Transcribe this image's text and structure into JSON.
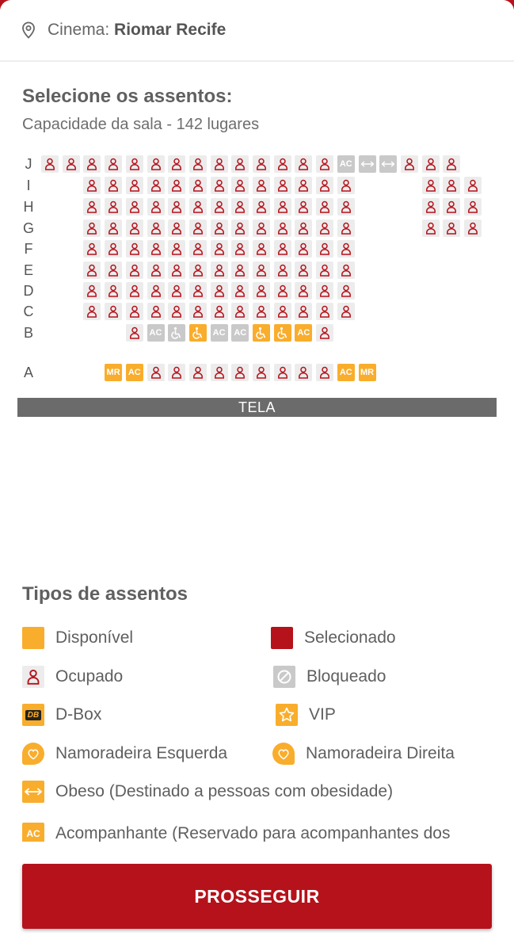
{
  "header": {
    "cinema_label": "Cinema:",
    "cinema_name": "Riomar Recife",
    "icon": "location-pin-icon"
  },
  "seat_selection": {
    "title": "Selecione os assentos:",
    "capacity": "Capacidade da sala - 142 lugares"
  },
  "seat_map": {
    "screen_label": "TELA",
    "rows": [
      {
        "label": "J",
        "seats": [
          {
            "col": 0,
            "type": "occupied"
          },
          {
            "col": 1,
            "type": "occupied"
          },
          {
            "col": 2,
            "type": "occupied"
          },
          {
            "col": 3,
            "type": "occupied"
          },
          {
            "col": 4,
            "type": "occupied"
          },
          {
            "col": 5,
            "type": "occupied"
          },
          {
            "col": 6,
            "type": "occupied"
          },
          {
            "col": 7,
            "type": "occupied"
          },
          {
            "col": 8,
            "type": "occupied"
          },
          {
            "col": 9,
            "type": "occupied"
          },
          {
            "col": 10,
            "type": "occupied"
          },
          {
            "col": 11,
            "type": "occupied"
          },
          {
            "col": 12,
            "type": "occupied"
          },
          {
            "col": 13,
            "type": "occupied"
          },
          {
            "col": 14,
            "type": "ac-blocked",
            "text": "AC"
          },
          {
            "col": 15,
            "type": "obese-blocked"
          },
          {
            "col": 16,
            "type": "obese-blocked"
          },
          {
            "col": 17,
            "type": "occupied"
          },
          {
            "col": 18,
            "type": "occupied"
          },
          {
            "col": 19,
            "type": "occupied"
          }
        ]
      },
      {
        "label": "I",
        "seats": [
          {
            "col": 2,
            "type": "occupied"
          },
          {
            "col": 3,
            "type": "occupied"
          },
          {
            "col": 4,
            "type": "occupied"
          },
          {
            "col": 5,
            "type": "occupied"
          },
          {
            "col": 6,
            "type": "occupied"
          },
          {
            "col": 7,
            "type": "occupied"
          },
          {
            "col": 8,
            "type": "occupied"
          },
          {
            "col": 9,
            "type": "occupied"
          },
          {
            "col": 10,
            "type": "occupied"
          },
          {
            "col": 11,
            "type": "occupied"
          },
          {
            "col": 12,
            "type": "occupied"
          },
          {
            "col": 13,
            "type": "occupied"
          },
          {
            "col": 14,
            "type": "occupied"
          },
          {
            "col": 18,
            "type": "occupied"
          },
          {
            "col": 19,
            "type": "occupied"
          },
          {
            "col": 20,
            "type": "occupied"
          }
        ]
      },
      {
        "label": "H",
        "seats": [
          {
            "col": 2,
            "type": "occupied"
          },
          {
            "col": 3,
            "type": "occupied"
          },
          {
            "col": 4,
            "type": "occupied"
          },
          {
            "col": 5,
            "type": "occupied"
          },
          {
            "col": 6,
            "type": "occupied"
          },
          {
            "col": 7,
            "type": "occupied"
          },
          {
            "col": 8,
            "type": "occupied"
          },
          {
            "col": 9,
            "type": "occupied"
          },
          {
            "col": 10,
            "type": "occupied"
          },
          {
            "col": 11,
            "type": "occupied"
          },
          {
            "col": 12,
            "type": "occupied"
          },
          {
            "col": 13,
            "type": "occupied"
          },
          {
            "col": 14,
            "type": "occupied"
          },
          {
            "col": 18,
            "type": "occupied"
          },
          {
            "col": 19,
            "type": "occupied"
          },
          {
            "col": 20,
            "type": "occupied"
          }
        ]
      },
      {
        "label": "G",
        "seats": [
          {
            "col": 2,
            "type": "occupied"
          },
          {
            "col": 3,
            "type": "occupied"
          },
          {
            "col": 4,
            "type": "occupied"
          },
          {
            "col": 5,
            "type": "occupied"
          },
          {
            "col": 6,
            "type": "occupied"
          },
          {
            "col": 7,
            "type": "occupied"
          },
          {
            "col": 8,
            "type": "occupied"
          },
          {
            "col": 9,
            "type": "occupied"
          },
          {
            "col": 10,
            "type": "occupied"
          },
          {
            "col": 11,
            "type": "occupied"
          },
          {
            "col": 12,
            "type": "occupied"
          },
          {
            "col": 13,
            "type": "occupied"
          },
          {
            "col": 14,
            "type": "occupied"
          },
          {
            "col": 18,
            "type": "occupied"
          },
          {
            "col": 19,
            "type": "occupied"
          },
          {
            "col": 20,
            "type": "occupied"
          }
        ]
      },
      {
        "label": "F",
        "seats": [
          {
            "col": 2,
            "type": "occupied"
          },
          {
            "col": 3,
            "type": "occupied"
          },
          {
            "col": 4,
            "type": "occupied"
          },
          {
            "col": 5,
            "type": "occupied"
          },
          {
            "col": 6,
            "type": "occupied"
          },
          {
            "col": 7,
            "type": "occupied"
          },
          {
            "col": 8,
            "type": "occupied"
          },
          {
            "col": 9,
            "type": "occupied"
          },
          {
            "col": 10,
            "type": "occupied"
          },
          {
            "col": 11,
            "type": "occupied"
          },
          {
            "col": 12,
            "type": "occupied"
          },
          {
            "col": 13,
            "type": "occupied"
          },
          {
            "col": 14,
            "type": "occupied"
          }
        ]
      },
      {
        "label": "E",
        "seats": [
          {
            "col": 2,
            "type": "occupied"
          },
          {
            "col": 3,
            "type": "occupied"
          },
          {
            "col": 4,
            "type": "occupied"
          },
          {
            "col": 5,
            "type": "occupied"
          },
          {
            "col": 6,
            "type": "occupied"
          },
          {
            "col": 7,
            "type": "occupied"
          },
          {
            "col": 8,
            "type": "occupied"
          },
          {
            "col": 9,
            "type": "occupied"
          },
          {
            "col": 10,
            "type": "occupied"
          },
          {
            "col": 11,
            "type": "occupied"
          },
          {
            "col": 12,
            "type": "occupied"
          },
          {
            "col": 13,
            "type": "occupied"
          },
          {
            "col": 14,
            "type": "occupied"
          }
        ]
      },
      {
        "label": "D",
        "seats": [
          {
            "col": 2,
            "type": "occupied"
          },
          {
            "col": 3,
            "type": "occupied"
          },
          {
            "col": 4,
            "type": "occupied"
          },
          {
            "col": 5,
            "type": "occupied"
          },
          {
            "col": 6,
            "type": "occupied"
          },
          {
            "col": 7,
            "type": "occupied"
          },
          {
            "col": 8,
            "type": "occupied"
          },
          {
            "col": 9,
            "type": "occupied"
          },
          {
            "col": 10,
            "type": "occupied"
          },
          {
            "col": 11,
            "type": "occupied"
          },
          {
            "col": 12,
            "type": "occupied"
          },
          {
            "col": 13,
            "type": "occupied"
          },
          {
            "col": 14,
            "type": "occupied"
          }
        ]
      },
      {
        "label": "C",
        "seats": [
          {
            "col": 2,
            "type": "occupied"
          },
          {
            "col": 3,
            "type": "occupied"
          },
          {
            "col": 4,
            "type": "occupied"
          },
          {
            "col": 5,
            "type": "occupied"
          },
          {
            "col": 6,
            "type": "occupied"
          },
          {
            "col": 7,
            "type": "occupied"
          },
          {
            "col": 8,
            "type": "occupied"
          },
          {
            "col": 9,
            "type": "occupied"
          },
          {
            "col": 10,
            "type": "occupied"
          },
          {
            "col": 11,
            "type": "occupied"
          },
          {
            "col": 12,
            "type": "occupied"
          },
          {
            "col": 13,
            "type": "occupied"
          },
          {
            "col": 14,
            "type": "occupied"
          }
        ]
      },
      {
        "label": "B",
        "seats": [
          {
            "col": 4,
            "type": "occupied"
          },
          {
            "col": 5,
            "type": "ac-blocked",
            "text": "AC"
          },
          {
            "col": 6,
            "type": "wheelchair-blocked"
          },
          {
            "col": 7,
            "type": "wheelchair-available"
          },
          {
            "col": 8,
            "type": "ac-blocked",
            "text": "AC"
          },
          {
            "col": 9,
            "type": "ac-blocked",
            "text": "AC"
          },
          {
            "col": 10,
            "type": "wheelchair-available"
          },
          {
            "col": 11,
            "type": "wheelchair-available"
          },
          {
            "col": 12,
            "type": "ac-available",
            "text": "AC"
          },
          {
            "col": 13,
            "type": "occupied"
          }
        ]
      },
      {
        "label": "A",
        "seats": [
          {
            "col": 3,
            "type": "mr-available",
            "text": "MR"
          },
          {
            "col": 4,
            "type": "ac-available",
            "text": "AC"
          },
          {
            "col": 5,
            "type": "occupied"
          },
          {
            "col": 6,
            "type": "occupied"
          },
          {
            "col": 7,
            "type": "occupied"
          },
          {
            "col": 8,
            "type": "occupied"
          },
          {
            "col": 9,
            "type": "occupied"
          },
          {
            "col": 10,
            "type": "occupied"
          },
          {
            "col": 11,
            "type": "occupied"
          },
          {
            "col": 12,
            "type": "occupied"
          },
          {
            "col": 13,
            "type": "occupied"
          },
          {
            "col": 14,
            "type": "ac-available",
            "text": "AC"
          },
          {
            "col": 15,
            "type": "mr-available",
            "text": "MR"
          }
        ]
      }
    ]
  },
  "legend": {
    "title": "Tipos de assentos",
    "items": [
      {
        "label": "Disponível",
        "icon": "available-square-icon"
      },
      {
        "label": "Selecionado",
        "icon": "selected-square-icon"
      },
      {
        "label": "Ocupado",
        "icon": "person-icon"
      },
      {
        "label": "Bloqueado",
        "icon": "blocked-icon"
      },
      {
        "label": "D-Box",
        "icon": "dbox-icon",
        "icon_text": "DB"
      },
      {
        "label": "VIP",
        "icon": "star-icon"
      },
      {
        "label": "Namoradeira Esquerda",
        "icon": "heart-icon"
      },
      {
        "label": "Namoradeira Direita",
        "icon": "heart-icon"
      },
      {
        "label": "Obeso (Destinado a pessoas com obesidade)",
        "icon": "double-arrow-icon"
      },
      {
        "label": "Acompanhante (Reservado para acompanhantes dos",
        "icon": "ac-icon",
        "icon_text": "AC"
      }
    ]
  },
  "actions": {
    "proceed_label": "PROSSEGUIR"
  },
  "colors": {
    "primary": "#b5121b",
    "available": "#f9ad2c",
    "occupied_bg": "#ececec",
    "blocked_bg": "#c9c9c9",
    "screen": "#6b6b6b"
  }
}
